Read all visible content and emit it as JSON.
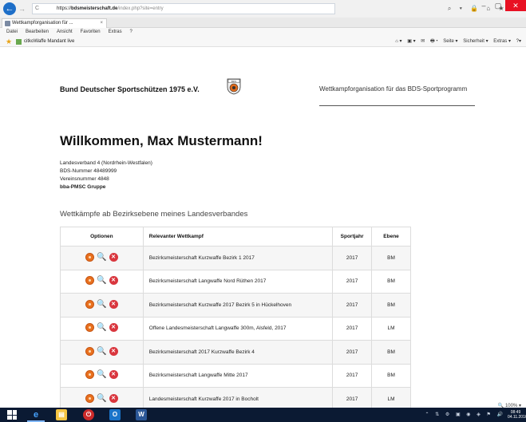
{
  "browser": {
    "back_glyph": "←",
    "forward_glyph": "→",
    "addr_icons": "C",
    "url_scheme": "https://",
    "url_domain": "bdsmeisterschaft.de",
    "url_path": "/index.php?site=entry",
    "tab_label": "Wettkampforganisation für ...",
    "tab_close": "×",
    "right_tools": "⌕ ▾ 🔒 ⌂ ★ ⚙",
    "minimize": "–",
    "maximize": "▢",
    "close": "✕",
    "menu": [
      "Datei",
      "Bearbeiten",
      "Ansicht",
      "Favoriten",
      "Extras",
      "?"
    ],
    "fav_star": "★",
    "fav_link": "citkoWaffe  Mandant live",
    "command_items": [
      "⌂ ▾",
      "▣ ▾",
      "✉",
      "🖶 ▾",
      "Seite ▾",
      "Sicherheit ▾",
      "Extras ▾",
      "?▾"
    ],
    "zoom": "🔍 100%  ▾"
  },
  "header": {
    "org_name": "Bund Deutscher Sportschützen 1975 e.V.",
    "logo_text": "BDS",
    "tagline": "Wettkampforganisation für das BDS-Sportprogramm"
  },
  "welcome": "Willkommen, Max Mustermann!",
  "user_info": {
    "verband": "Landesverband 4 (Nordrhein-Westfalen)",
    "bds_nr": "BDS-Nummer 48489999",
    "verein_nr": "Vereinsnummer 4848",
    "gruppe": "bba-PMSC Gruppe"
  },
  "section_title": "Wettkämpfe ab Bezirksebene meines Landesverbandes",
  "table": {
    "headers": [
      "Optionen",
      "Relevanter Wettkampf",
      "Sportjahr",
      "Ebene"
    ],
    "delete_glyph": "✕",
    "search_glyph": "🔍",
    "rows": [
      {
        "competition": "Bezirksmeisterschaft Kurzwaffe Bezirk 1 2017",
        "year": "2017",
        "level": "BM"
      },
      {
        "competition": "Bezirksmeisterschaft Langwaffe Nord Rüthen 2017",
        "year": "2017",
        "level": "BM"
      },
      {
        "competition": "Bezirksmeisterschaft Kurzwaffe 2017 Bezirk 5 in Hückelhoven",
        "year": "2017",
        "level": "BM"
      },
      {
        "competition": "Offene Landesmeisterschaft Langwaffe 300m, Alsfeld, 2017",
        "year": "2017",
        "level": "LM"
      },
      {
        "competition": "Bezirksmeisterschaft 2017 Kurzwaffe Bezirk 4",
        "year": "2017",
        "level": "BM"
      },
      {
        "competition": "Bezirksmeisterschaft Langwaffe Mitte 2017",
        "year": "2017",
        "level": "BM"
      },
      {
        "competition": "Landesmeisterschaft Kurzwaffe 2017 in Bocholt",
        "year": "2017",
        "level": "LM"
      }
    ]
  },
  "taskbar": {
    "ie": "e",
    "files": "▤",
    "red_app": "⏻",
    "outlook": "O",
    "word": "W",
    "tray": "⌃ ⇅ ⚙ ▣ ◉ ◈ ⚑ 🔊",
    "time": "08:49",
    "date": "04.11.2016"
  }
}
